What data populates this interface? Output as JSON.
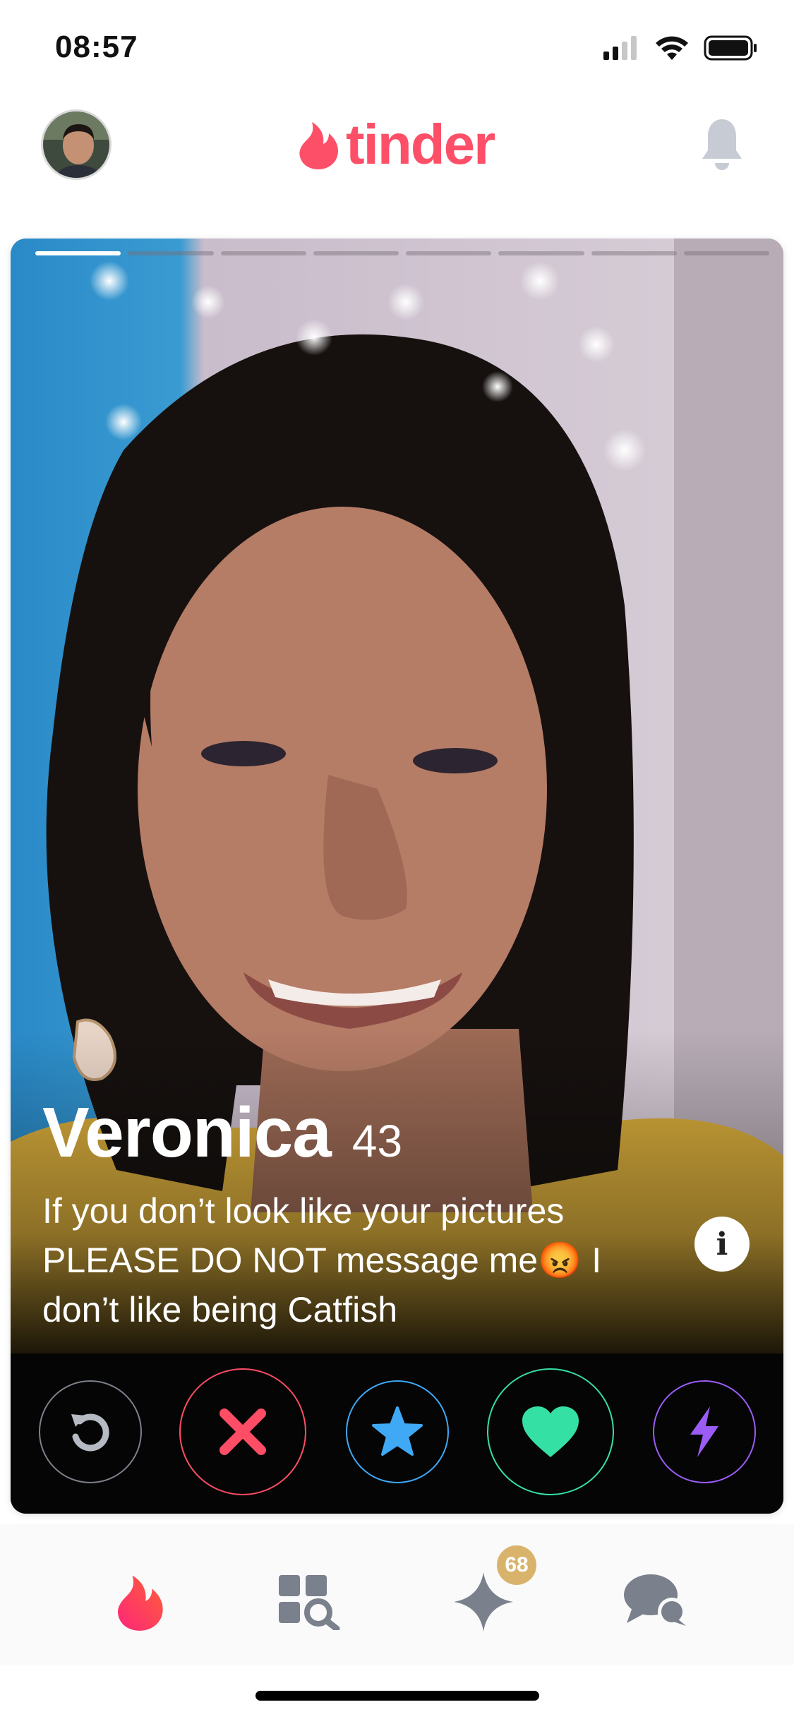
{
  "status_bar": {
    "time": "08:57",
    "icons": [
      "cellular-signal-icon",
      "wifi-icon",
      "battery-icon"
    ]
  },
  "header": {
    "logo_text": "tinder",
    "icons": [
      "profile-avatar",
      "flame-logo-icon",
      "notification-bell-icon"
    ]
  },
  "card": {
    "photo_count": 8,
    "current_photo": 1,
    "name": "Veronica",
    "age": "43",
    "bio_line1": "If you don’t look like your pictures",
    "bio_line2_start": "PLEASE DO NOT message me",
    "bio_emoji": "😡",
    "bio_line2_end": " I",
    "bio_line3": "don’t like being Catfish",
    "info_label": "i"
  },
  "actions": [
    {
      "name": "rewind",
      "icon": "rewind-icon",
      "color": "#b5bac3"
    },
    {
      "name": "nope",
      "icon": "x-icon",
      "color": "#fe4d65"
    },
    {
      "name": "super-like",
      "icon": "star-icon",
      "color": "#3fa9f5"
    },
    {
      "name": "like",
      "icon": "heart-icon",
      "color": "#35e0a5"
    },
    {
      "name": "boost",
      "icon": "lightning-icon",
      "color": "#9b5cf6"
    }
  ],
  "tabbar": {
    "tabs": [
      "flame-tab-icon",
      "explore-tab-icon",
      "likes-tab-icon",
      "messages-tab-icon"
    ],
    "likes_badge": "68"
  },
  "colors": {
    "brand": "#fd5068",
    "inactive_icon": "#7a808c"
  }
}
